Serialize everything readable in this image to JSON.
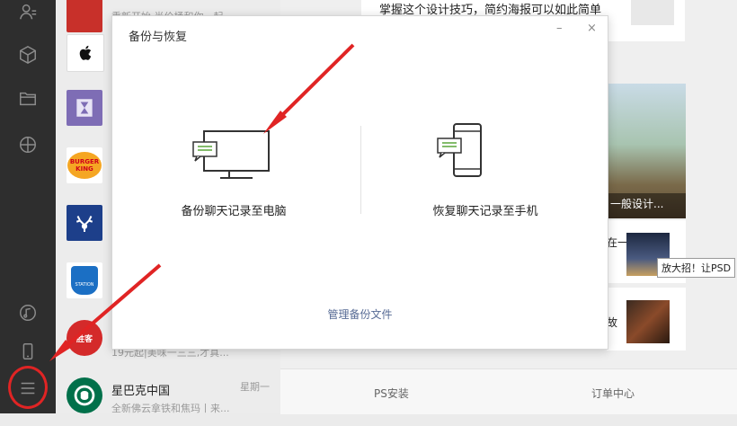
{
  "dialog": {
    "title": "备份与恢复",
    "backup_label": "备份聊天记录至电脑",
    "restore_label": "恢复聊天记录至手机",
    "manage_label": "管理备份文件",
    "minimize": "–",
    "close": "×"
  },
  "chats": [
    {
      "name": "",
      "msg": "重新开始,半价桶和你一起..."
    },
    {
      "name": "",
      "msg": ""
    },
    {
      "name": "",
      "msg": ""
    },
    {
      "name": "",
      "msg": ""
    },
    {
      "name": "",
      "msg": ""
    },
    {
      "name": "",
      "msg": ""
    },
    {
      "name": "",
      "msg": "19元起|美味一三三,才真..."
    },
    {
      "name": "星巴克中国",
      "msg": "全新佛云拿铁和焦玛丨来...",
      "time": "星期一"
    }
  ],
  "avatars": {
    "burger_king": "BURGER KING",
    "station": "STATION",
    "shengke": "胜客"
  },
  "feed": {
    "headline": "掌握这个设计技巧，简约海报可以如此简单",
    "card_caption": "一般设计...",
    "snippet1": "在一",
    "snippet2": "故"
  },
  "tooltip": "放大招！让PSD",
  "bottom_tabs": [
    "PS安装",
    "订单中心"
  ]
}
